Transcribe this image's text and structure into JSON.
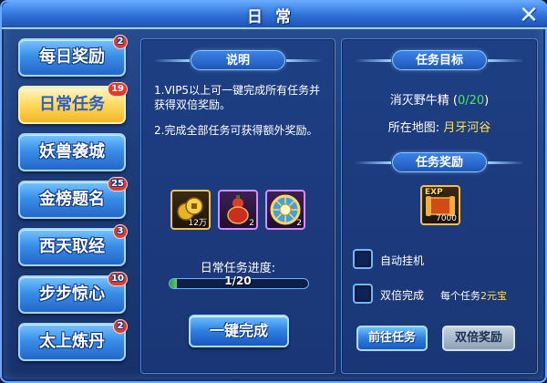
{
  "window": {
    "title": "日常",
    "close_icon": "close-icon"
  },
  "nav": {
    "items": [
      {
        "label": "每日奖励",
        "badge": "2",
        "active": false
      },
      {
        "label": "日常任务",
        "badge": "19",
        "active": true
      },
      {
        "label": "妖兽袭城",
        "badge": "",
        "active": false
      },
      {
        "label": "金榜题名",
        "badge": "25",
        "active": false
      },
      {
        "label": "西天取经",
        "badge": "3",
        "active": false
      },
      {
        "label": "步步惊心",
        "badge": "10",
        "active": false
      },
      {
        "label": "太上炼丹",
        "badge": "2",
        "active": false
      }
    ]
  },
  "middle": {
    "header": "说明",
    "desc1": "1.VIP5以上可一键完成所有任务并获得双倍奖励。",
    "desc2": "2.完成全部任务可获得额外奖励。",
    "rewards": [
      {
        "icon": "gold-coins-icon",
        "qty": "12万"
      },
      {
        "icon": "gourd-potion-icon",
        "qty": "2"
      },
      {
        "icon": "prize-wheel-icon",
        "qty": "2"
      }
    ],
    "progress_label": "日常任务进度:",
    "progress_text": "1/20",
    "progress_value": 0.05,
    "one_click_label": "一键完成"
  },
  "right": {
    "target_header": "任务目标",
    "target_prefix": "消灭野牛精 (",
    "target_count": "0/20",
    "target_suffix": ")",
    "map_prefix": "所在地图:",
    "map_name": "月牙河谷",
    "reward_header": "任务奖励",
    "exp_icon": "exp-scroll-icon",
    "exp_label": "EXP",
    "exp_value": "7000",
    "auto_hang_label": "自动挂机",
    "double_label": "双倍完成",
    "double_cost_prefix": "每个任务",
    "double_cost_value": "2元宝",
    "goto_label": "前往任务",
    "double_reward_label": "双倍奖励"
  },
  "colors": {
    "accent": "#2e6fd6",
    "gold": "#f1c24c",
    "green": "#4fe36a",
    "yellow": "#ffe14a",
    "badge": "#e23a2a"
  }
}
